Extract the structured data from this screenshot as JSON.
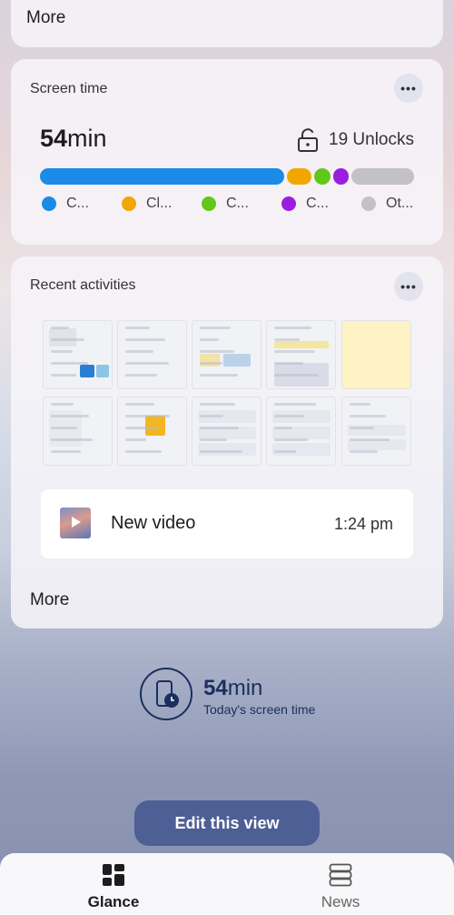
{
  "top_card": {
    "more_label": "More"
  },
  "screen_time": {
    "title": "Screen time",
    "total_number": "54",
    "total_unit": "min",
    "unlocks": "19 Unlocks",
    "usage_segments": [
      {
        "color": "#1a8ce8",
        "fraction": 0.66
      },
      {
        "color": "#f0a800",
        "fraction": 0.065
      },
      {
        "color": "#61c81a",
        "fraction": 0.045
      },
      {
        "color": "#9b1ee0",
        "fraction": 0.04
      },
      {
        "color": "#c1c1c6",
        "fraction": 0.17
      }
    ],
    "legend": [
      {
        "label": "C...",
        "color": "#1a8ce8"
      },
      {
        "label": "Cl...",
        "color": "#f0a800"
      },
      {
        "label": "C...",
        "color": "#61c81a"
      },
      {
        "label": "C...",
        "color": "#9b1ee0"
      },
      {
        "label": "Ot...",
        "color": "#c1c1c6"
      }
    ],
    "more_icon": "more-dots-icon"
  },
  "recent_activities": {
    "title": "Recent activities",
    "more_icon": "more-dots-icon",
    "video": {
      "title": "New video",
      "time": "1:24 pm"
    },
    "more_label": "More"
  },
  "screen_time_summary": {
    "number": "54",
    "unit": "min",
    "caption": "Today's screen time",
    "icon": "phone-clock-icon"
  },
  "edit_button": {
    "label": "Edit this view"
  },
  "bottom_nav": {
    "items": [
      {
        "label": "Glance",
        "icon": "grid-icon",
        "active": true
      },
      {
        "label": "News",
        "icon": "news-stack-icon",
        "active": false
      }
    ]
  }
}
